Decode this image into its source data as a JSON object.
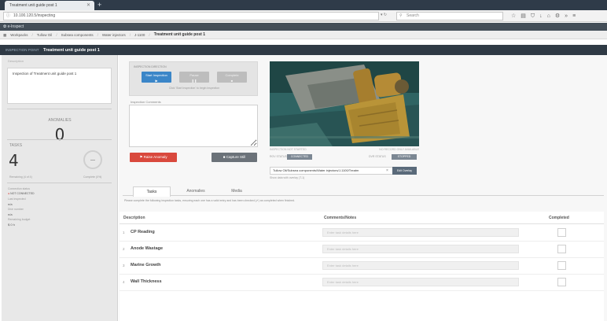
{
  "browser": {
    "tab_title": "Treatment unit guide post 1",
    "url": "10.100.120.5/inspecting",
    "search_placeholder": "Search"
  },
  "app": {
    "name": "e-Inspect"
  },
  "breadcrumb": {
    "items": [
      "Workpacks",
      "Tullow Oil",
      "Subsea components",
      "Water injectors",
      "J-1100"
    ],
    "current": "Treatment unit guide post 1"
  },
  "titlebar": {
    "prefix": "INSPECTION POINT",
    "title": "Treatment unit guide post 1"
  },
  "sidebar": {
    "heading": "Description",
    "description": "Inspection of Treatment unit guide post 1",
    "anomalies_label": "ANOMALIES",
    "anomalies_value": "0",
    "tasks_label": "TASKS",
    "tasks_value": "4",
    "tasks_left_caption": "Remaining (4 of 4)",
    "tasks_right_caption": "Complete (0%)",
    "status_label": "Connection status",
    "status_value": "NOT CONNECTED",
    "field1_label": "Last inspected",
    "field1_value": "n/a",
    "field2_label": "Dive number",
    "field2_value": "n/a",
    "field3_label": "Remaining budget",
    "field3_value": "$ 0 h"
  },
  "inspection": {
    "panel_label": "INSPECTION DIRECTION",
    "start_label": "Start Inspection",
    "pause_label": "Pause",
    "stop_label": "Complete",
    "hint": "Click 'Start Inspection' to begin inspection",
    "comments_label": "Inspection Comments",
    "anomaly_button": "Raise Anomaly",
    "capture_button": "Capture Still"
  },
  "video": {
    "left_caption": "INSPECTION NOT STARTED",
    "right_caption": "NO RECORD ONLY AVAILABLE",
    "ctrl_left_label": "ROV STATUS",
    "ctrl_left_value": "CONNECTED",
    "ctrl_right_label": "DVR STATUS",
    "ctrl_right_value": "STOPPED",
    "follow_path": "Tullow Oil/Subsea components/Water injectors/J-1100/Treatm",
    "edit_button": "Edit Overlay",
    "show_data": "Show data with overlay (T-1)"
  },
  "tabs": [
    {
      "label": "Tasks",
      "active": true
    },
    {
      "label": "Anomalies",
      "active": false
    },
    {
      "label": "Media",
      "active": false
    }
  ],
  "instructions": "Please complete the following inspection tasks, ensuring each one has a valid entry and has been checked (✔) as completed when finished.",
  "table": {
    "headers": {
      "description": "Description",
      "comments": "Comments/Notes",
      "completed": "Completed"
    },
    "note_placeholder": "Enter task details here",
    "rows": [
      {
        "num": "1",
        "name": "CP Reading"
      },
      {
        "num": "2",
        "name": "Anode Wastage"
      },
      {
        "num": "3",
        "name": "Marine Growth"
      },
      {
        "num": "4",
        "name": "Wall Thickness"
      }
    ]
  }
}
